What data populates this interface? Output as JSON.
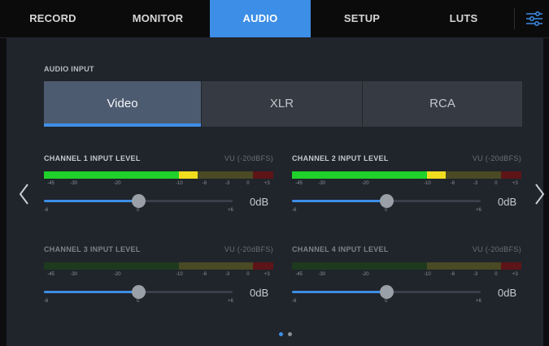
{
  "tabs": [
    {
      "label": "RECORD"
    },
    {
      "label": "MONITOR"
    },
    {
      "label": "AUDIO"
    },
    {
      "label": "SETUP"
    },
    {
      "label": "LUTS"
    }
  ],
  "active_tab": "AUDIO",
  "audio_input": {
    "label": "AUDIO INPUT",
    "options": [
      "Video",
      "XLR",
      "RCA"
    ],
    "selected": "Video"
  },
  "scale": {
    "meter_ticks": [
      "-45",
      "-30",
      "-20",
      "-10",
      "-6",
      "-3",
      "0",
      "+3"
    ],
    "slider_labels": [
      "-6",
      "0",
      "+6"
    ]
  },
  "channels": [
    {
      "title": "CHANNEL 1 INPUT LEVEL",
      "vu": "VU (-20dBFS)",
      "gain": "0dB",
      "active": true,
      "slider_value_db": 0
    },
    {
      "title": "CHANNEL 2 INPUT LEVEL",
      "vu": "VU (-20dBFS)",
      "gain": "0dB",
      "active": true,
      "slider_value_db": 0
    },
    {
      "title": "CHANNEL 3 INPUT LEVEL",
      "vu": "VU (-20dBFS)",
      "gain": "0dB",
      "active": false,
      "slider_value_db": 0
    },
    {
      "title": "CHANNEL 4 INPUT LEVEL",
      "vu": "VU (-20dBFS)",
      "gain": "0dB",
      "active": false,
      "slider_value_db": 0
    }
  ],
  "pagination": {
    "pages": 2,
    "current": 1
  },
  "colors": {
    "accent": "#3d8ee6",
    "meter_green": "#1fd12a",
    "meter_yellow": "#f0dd1e",
    "meter_dim_green": "#1e3a1e",
    "meter_olive": "#4a4a24",
    "meter_red": "#5e1518"
  },
  "icons": [
    "menu-sliders-icon",
    "chevron-left-icon",
    "chevron-right-icon"
  ]
}
